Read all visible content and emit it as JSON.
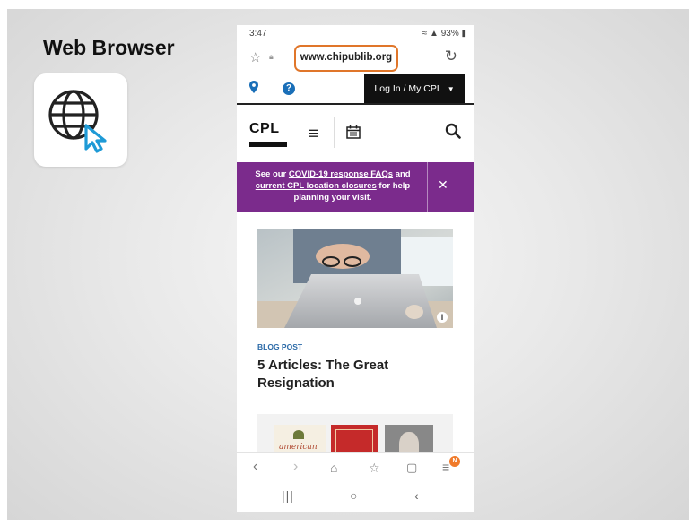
{
  "slide": {
    "title": "Web Browser",
    "app_icon": "globe-cursor-icon"
  },
  "phone": {
    "status": {
      "time": "3:47",
      "battery": "93%"
    },
    "urlbar": {
      "url": "www.chipublib.org",
      "highlight_color": "#e0762a"
    },
    "site": {
      "login_label": "Log In / My CPL",
      "logo_text": "CPL",
      "banner": {
        "text_1": "See our ",
        "link_1": "COVID-19 response FAQs",
        "text_2": " and ",
        "link_2": "current CPL location closures",
        "text_3": " for help planning your visit.",
        "background": "#7b2b8c"
      },
      "article": {
        "tag": "BLOG POST",
        "title": "5 Articles: The Great Resignation",
        "image_info": "i"
      },
      "book_cover_text": "american"
    },
    "bottom_nav": {
      "badge": "N"
    }
  }
}
